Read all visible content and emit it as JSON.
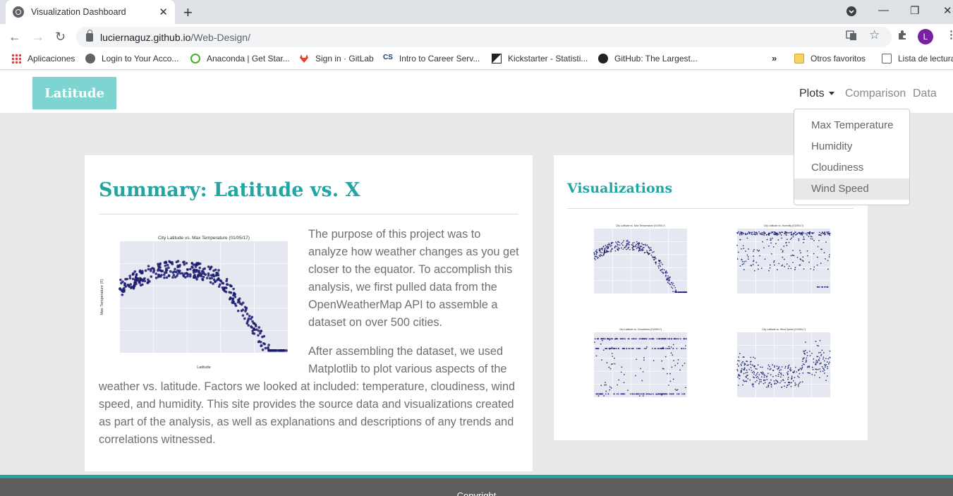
{
  "browser": {
    "tab_title": "Visualization Dashboard",
    "url_host": "luciernaguz.github.io",
    "url_path": "/Web-Design/",
    "profile_initial": "L",
    "bookmarks": [
      "Aplicaciones",
      "Login to Your Acco...",
      "Anaconda | Get Star...",
      "Sign in · GitLab",
      "Intro to Career Serv...",
      "Kickstarter - Statisti...",
      "GitHub: The Largest...",
      "Otros favoritos",
      "Lista de lectura"
    ],
    "cs_badge": "CS"
  },
  "nav": {
    "brand": "Latitude",
    "plots": "Plots",
    "comparison": "Comparison",
    "data": "Data",
    "dropdown": [
      "Max Temperature",
      "Humidity",
      "Cloudiness",
      "Wind Speed"
    ]
  },
  "summary": {
    "title": "Summary: Latitude vs. X",
    "paragraph1": "The purpose of this project was to analyze how weather changes as you get closer to the equator. To accomplish this analysis, we first pulled data from the OpenWeatherMap API to assemble a dataset on over 500 cities.",
    "paragraph2": "After assembling the dataset, we used Matplotlib to plot various aspects of the weather vs. latitude. Factors we looked at included: temperature, cloudiness, wind speed, and humidity. This site provides the source data and visualizations created as part of the analysis, as well as explanations and descriptions of any trends and correlations witnessed.",
    "plot_title": "City Latitude vs. Max Temperature (01/05/17)",
    "plot_xlabel": "Latitude",
    "plot_ylabel": "Max Temperature (F)"
  },
  "visualizations": {
    "title": "Visualizations",
    "thumbs": [
      {
        "title": "City Latitude vs. Max Temperature (01/05/17)",
        "kind": "temperature"
      },
      {
        "title": "City Latitude vs. Humidity (01/05/17)",
        "kind": "humidity"
      },
      {
        "title": "City Latitude vs. Cloudiness (01/05/17)",
        "kind": "cloudiness"
      },
      {
        "title": "City Latitude vs. Wind Speed (01/05/17)",
        "kind": "wind"
      }
    ]
  },
  "footer": {
    "text": "Copyright"
  },
  "colors": {
    "accent": "#22a5a3",
    "brand_bg": "#7ed4d1",
    "point": "#1a1a6e",
    "plot_bg": "#e5e8f0"
  }
}
